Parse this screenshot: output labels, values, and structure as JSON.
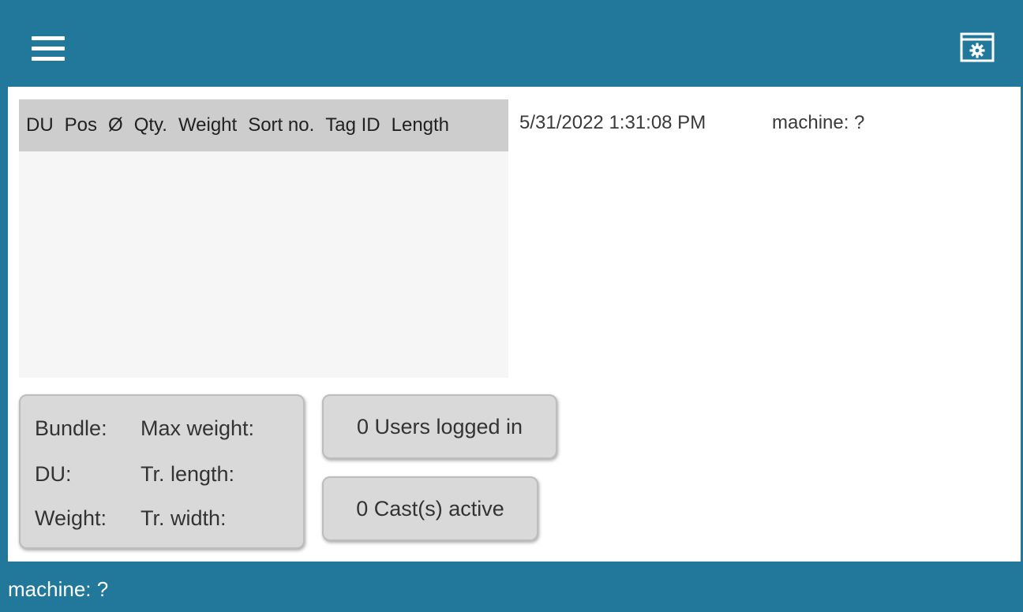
{
  "topbar": {
    "menu_icon": "hamburger-menu-icon",
    "settings_icon": "window-settings-icon",
    "accent_color": "#21789a"
  },
  "table": {
    "columns": [
      "DU",
      "Pos",
      "Ø",
      "Qty.",
      "Weight",
      "Sort no.",
      "Tag ID",
      "Length"
    ],
    "rows": []
  },
  "header_info": {
    "datetime": "5/31/2022 1:31:08 PM",
    "machine": "machine: ?"
  },
  "bundle_info": {
    "bundle_label": "Bundle:",
    "max_weight_label": "Max weight:",
    "du_label": "DU:",
    "tr_length_label": "Tr. length:",
    "weight_label": "Weight:",
    "tr_width_label": "Tr. width:"
  },
  "users": {
    "label": "0 Users logged in"
  },
  "casts": {
    "label": "0 Cast(s) active"
  },
  "statusbar": {
    "text": "machine: ?"
  }
}
